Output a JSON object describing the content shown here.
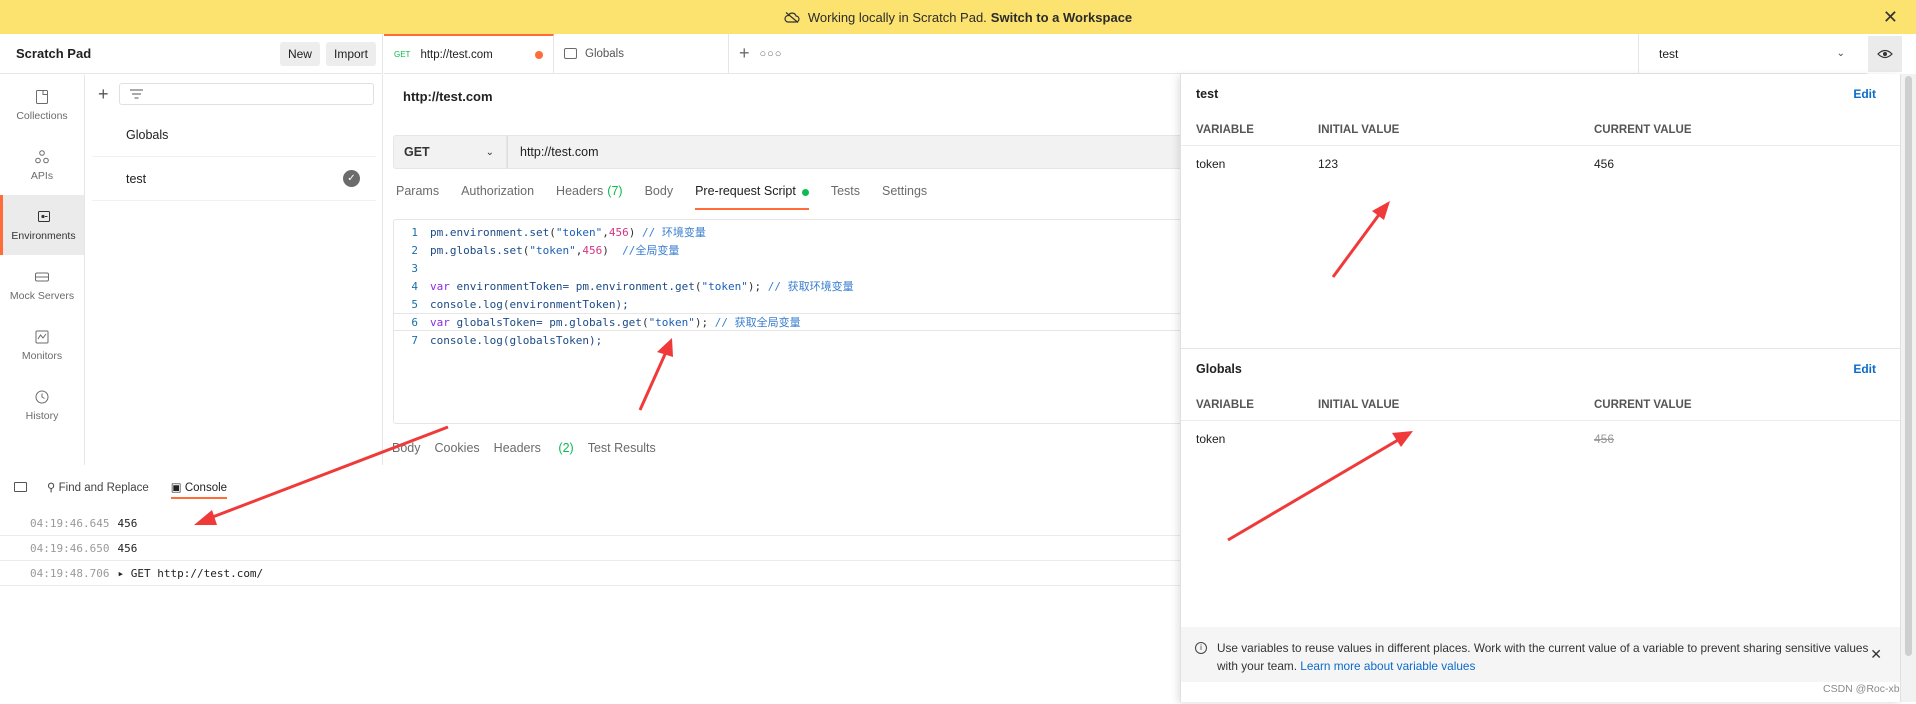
{
  "banner": {
    "text": "Working locally in Scratch Pad.",
    "link": "Switch to a Workspace"
  },
  "sidebar": {
    "title": "Scratch Pad",
    "new_label": "New",
    "import_label": "Import",
    "nav": [
      "Collections",
      "APIs",
      "Environments",
      "Mock Servers",
      "Monitors",
      "History"
    ],
    "active_nav": "Environments"
  },
  "env_list": {
    "items": [
      "Globals",
      "test"
    ]
  },
  "tabs": [
    {
      "method": "GET",
      "label": "http://test.com"
    },
    {
      "label": "Globals"
    }
  ],
  "env_selector": {
    "value": "test"
  },
  "request": {
    "title": "http://test.com",
    "method": "GET",
    "url": "http://test.com",
    "tabs": [
      "Params",
      "Authorization",
      "Headers",
      "Body",
      "Pre-request Script",
      "Tests",
      "Settings"
    ],
    "headers_count": "(7)",
    "active_tab": "Pre-request Script"
  },
  "script": {
    "line_numbers": [
      "1",
      "2",
      "3",
      "4",
      "5",
      "6",
      "7"
    ],
    "l1": {
      "a": "pm.environment.",
      "b": "set",
      "c": "(",
      "d": "\"token\"",
      "e": ",",
      "f": "456",
      "g": ") ",
      "h": "// 环境变量"
    },
    "l2": {
      "a": "pm.globals.",
      "b": "set",
      "c": "(",
      "d": "\"token\"",
      "e": ",",
      "f": "456",
      "g": ")  ",
      "h": "//全局变量"
    },
    "l4": {
      "kw": "var",
      "a": " environmentToken= pm.environment.",
      "b": "get",
      "c": "(",
      "d": "\"token\"",
      "e": "); ",
      "h": "// 获取环境变量"
    },
    "l5": {
      "a": "console.",
      "b": "log",
      "c": "(environmentToken);"
    },
    "l6": {
      "kw": "var",
      "a": " globalsToken= pm.globals.",
      "b": "get",
      "c": "(",
      "d": "\"token\"",
      "e": "); ",
      "h": "// 获取全局变量"
    },
    "l7": {
      "a": "console.",
      "b": "log",
      "c": "(globalsToken);"
    }
  },
  "response_tabs": {
    "body": "Body",
    "cookies": "Cookies",
    "headers": "Headers",
    "headers_count": "(2)",
    "test_results": "Test Results"
  },
  "console": {
    "find_replace": "Find and Replace",
    "console_label": "Console",
    "logs": [
      {
        "time": "04:19:46.645",
        "msg": "456"
      },
      {
        "time": "04:19:46.650",
        "msg": "456"
      },
      {
        "time": "04:19:48.706",
        "msg": "▸ GET http://test.com/"
      }
    ]
  },
  "env_panel": {
    "sections": [
      {
        "name": "test",
        "edit": "Edit",
        "columns": [
          "VARIABLE",
          "INITIAL VALUE",
          "CURRENT VALUE"
        ],
        "rows": [
          {
            "variable": "token",
            "initial": "123",
            "current": "456"
          }
        ]
      },
      {
        "name": "Globals",
        "edit": "Edit",
        "columns": [
          "VARIABLE",
          "INITIAL VALUE",
          "CURRENT VALUE"
        ],
        "rows": [
          {
            "variable": "token",
            "initial": "",
            "current": "456"
          }
        ]
      }
    ],
    "info": "Use variables to reuse values in different places. Work with the current value of a variable to prevent sharing sensitive values with your team.",
    "info_link": "Learn more about variable values"
  },
  "watermark": "CSDN @Roc-xb",
  "colors": {
    "accent": "#ff6c37",
    "banner": "#fce26f",
    "link": "#0b6bcb",
    "success": "#0cbb52",
    "annotation_arrow": "#f03a3a"
  }
}
